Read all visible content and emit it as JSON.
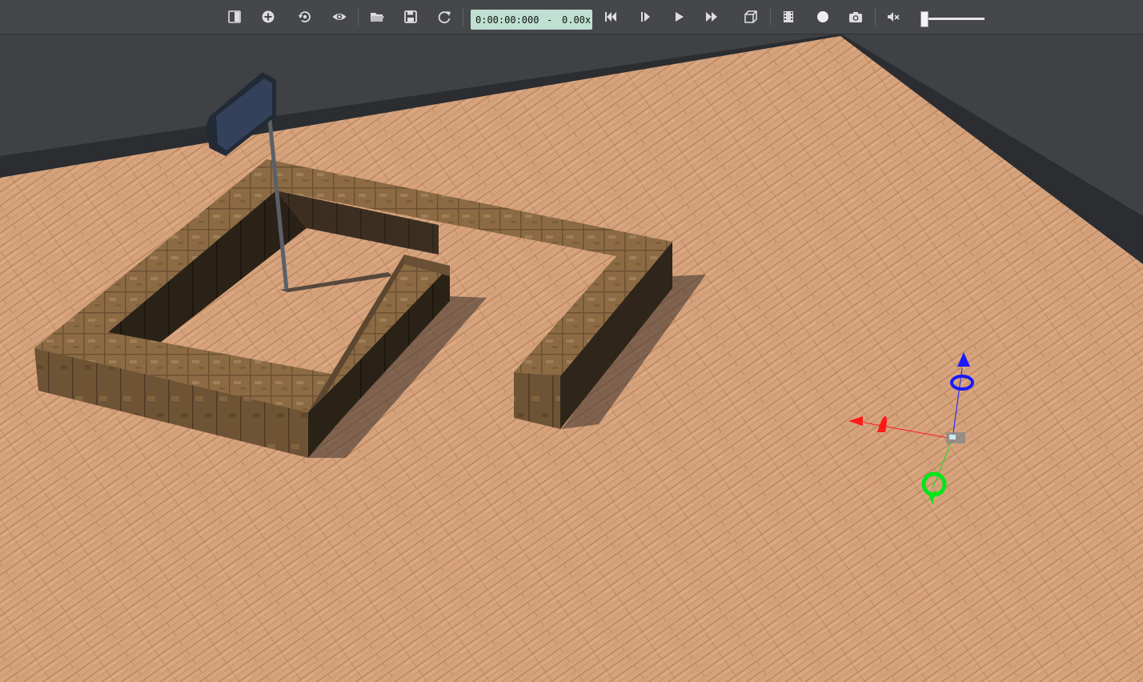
{
  "toolbar": {
    "time_display": "0:00:00:000",
    "time_separator": "-",
    "speed_display": "0.00x",
    "volume_level": 0.05,
    "buttons": [
      {
        "name": "panel-toggle-icon"
      },
      {
        "name": "add-icon"
      },
      {
        "name": "refresh-view-icon"
      },
      {
        "name": "eye-icon"
      },
      {
        "name": "folder-open-icon"
      },
      {
        "name": "save-icon"
      },
      {
        "name": "reload-icon"
      },
      {
        "name": "skip-back-icon"
      },
      {
        "name": "step-forward-icon"
      },
      {
        "name": "play-icon"
      },
      {
        "name": "fast-forward-icon"
      },
      {
        "name": "cube-view-icon"
      },
      {
        "name": "film-icon"
      },
      {
        "name": "record-icon"
      },
      {
        "name": "camera-icon"
      },
      {
        "name": "mute-icon"
      }
    ]
  },
  "scene": {
    "floor_material": "light-wood-planks",
    "wall_color": "#2b2d31",
    "brick_color": "#8a6a45",
    "gizmo_colors": {
      "x": "#ff1a1a",
      "y": "#00e61a",
      "z": "#1a1aff"
    }
  }
}
